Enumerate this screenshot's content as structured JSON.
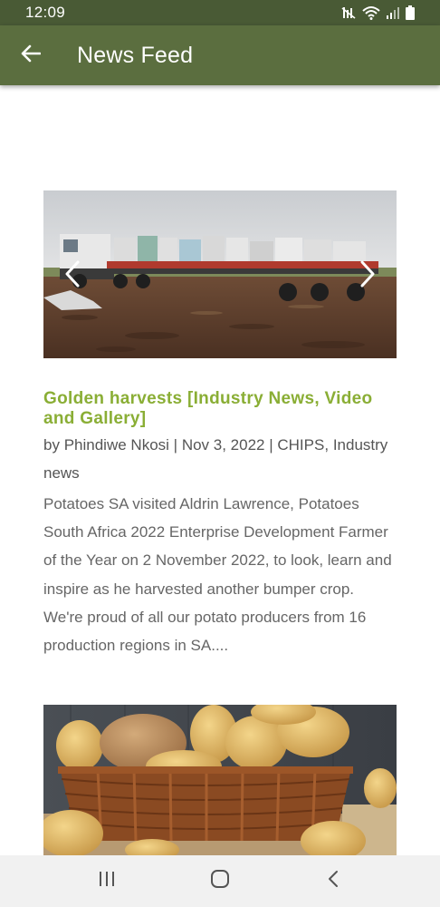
{
  "status_bar": {
    "time": "12:09",
    "icons": [
      "mute-icon",
      "wifi-icon",
      "signal-icon",
      "battery-icon"
    ]
  },
  "app_bar": {
    "back_icon": "arrow-left-icon",
    "title": "News Feed"
  },
  "posts": [
    {
      "image": {
        "description": "truck loaded with potato bulk bags in a harvested field",
        "prev_icon": "chevron-left-icon",
        "next_icon": "chevron-right-icon"
      },
      "title": "Golden harvests [Industry News, Video and Gallery]",
      "meta": {
        "by": "by",
        "author": "Phindiwe Nkosi",
        "sep1": " | ",
        "date": "Nov 3, 2022",
        "sep2": " | ",
        "category1": "CHIPS",
        "comma": ",",
        "category2": "Industry news"
      },
      "excerpt": "Potatoes SA visited Aldrin Lawrence, Potatoes South Africa 2022 Enterprise Development Farmer of the Year on 2 November 2022, to look, learn and inspire as he harvested another bumper crop. We're proud of all our potato producers from 16 production regions in SA...."
    },
    {
      "image": {
        "description": "potatoes in a wicker basket"
      }
    }
  ],
  "nav_bar": {
    "icons": [
      "recent-apps-icon",
      "home-icon",
      "back-icon"
    ]
  },
  "colors": {
    "status_bar": "#495a35",
    "app_bar": "#5b6e3f",
    "post_title": "#8aae35",
    "text": "#666666"
  }
}
